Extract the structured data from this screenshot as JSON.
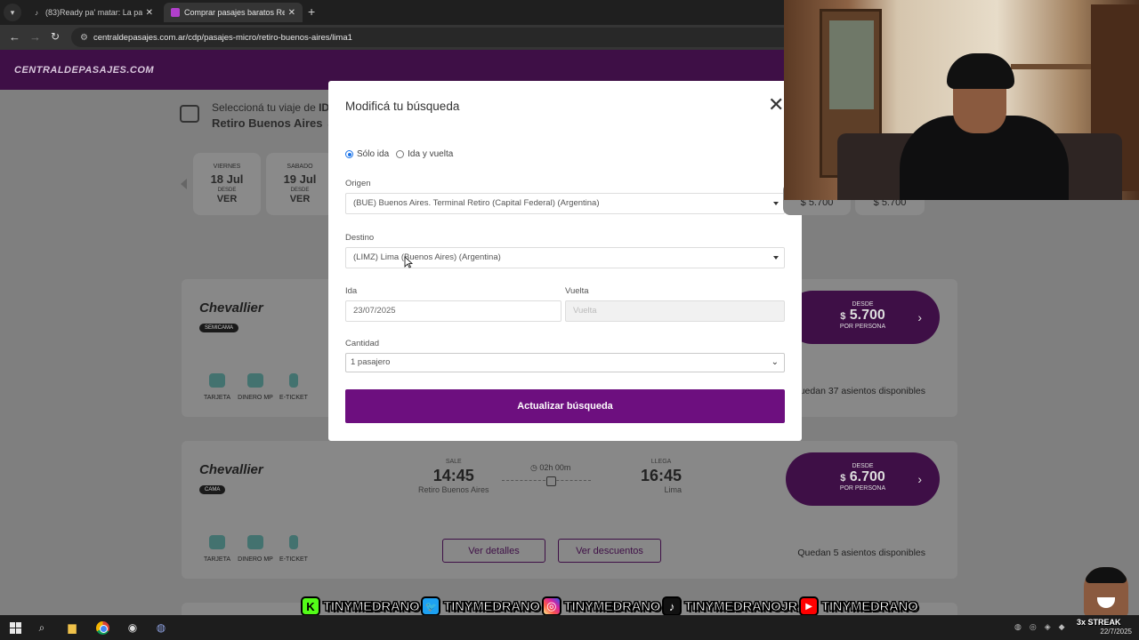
{
  "browser": {
    "tabs": [
      {
        "title": "(83)Ready pa' matar: La pasión d",
        "icon": "tiktok-icon"
      },
      {
        "title": "Comprar pasajes baratos Retiro",
        "icon": "site-icon",
        "active": true
      }
    ],
    "url": "centraldepasajes.com.ar/cdp/pasajes-micro/retiro-buenos-aires/lima1"
  },
  "site": {
    "logo": "CENTRALDEPASAJES.COM"
  },
  "trip": {
    "select_text": "Seleccioná tu viaje de",
    "select_strong": "IDA",
    "origin": "Retiro Buenos Aires",
    "arrow": "→"
  },
  "dates": [
    {
      "dow": "VIERNES",
      "date": "18 Jul",
      "desde": "DESDE",
      "ver": "VER"
    },
    {
      "dow": "SABADO",
      "date": "19 Jul",
      "desde": "DESDE",
      "ver": "VER"
    }
  ],
  "right_prices": [
    "$ 5.700",
    "$ 5.700"
  ],
  "results": [
    {
      "company": "Chevallier",
      "seat_type": "SEMICAMA",
      "price_desde": "DESDE",
      "price_currency": "$",
      "price": "5.700",
      "per_person": "POR PERSONA",
      "seats_text": "Quedan 37 asientos disponibles",
      "amenities": [
        "TARJETA",
        "DINERO MP",
        "E-TICKET"
      ]
    },
    {
      "company": "Chevallier",
      "seat_type": "CAMA",
      "sale_label": "SALE",
      "depart_time": "14:45",
      "depart_place": "Retiro Buenos Aires",
      "duration": "02h 00m",
      "arrive_label": "LLEGA",
      "arrive_time": "16:45",
      "arrive_place": "Lima",
      "details_button": "Ver detalles",
      "discounts_button": "Ver descuentos",
      "price_desde": "DESDE",
      "price_currency": "$",
      "price": "6.700",
      "per_person": "POR PERSONA",
      "seats_text": "Quedan 5 asientos disponibles",
      "amenities": [
        "TARJETA",
        "DINERO MP",
        "E-TICKET"
      ]
    }
  ],
  "modal": {
    "title": "Modificá tu búsqueda",
    "trip_type": {
      "one_way": "Sólo ida",
      "round_trip": "Ida y vuelta",
      "selected": "Sólo ida"
    },
    "origin_label": "Origen",
    "origin_value": "(BUE) Buenos Aires. Terminal Retiro (Capital Federal) (Argentina)",
    "destination_label": "Destino",
    "destination_value": "(LIMZ) Lima (Buenos Aires) (Argentina)",
    "ida_label": "Ida",
    "ida_value": "23/07/2025",
    "vuelta_label": "Vuelta",
    "vuelta_placeholder": "Vuelta",
    "cantidad_label": "Cantidad",
    "cantidad_value": "1 pasajero",
    "submit": "Actualizar búsqueda"
  },
  "social": [
    {
      "icon": "kick-icon",
      "name": "TINYMEDRANO",
      "color": "#53fc18",
      "glyph": "K"
    },
    {
      "icon": "twitter-icon",
      "name": "TINYMEDRANO",
      "color": "#1da1f2",
      "glyph": "🐦"
    },
    {
      "icon": "instagram-icon",
      "name": "TINYMEDRANO",
      "color": "#d6249f",
      "glyph": "◎"
    },
    {
      "icon": "tiktok-icon",
      "name": "TINYMEDRANOJR",
      "color": "#111111",
      "glyph": "♪"
    },
    {
      "icon": "youtube-icon",
      "name": "TINYMEDRANO",
      "color": "#ff0000",
      "glyph": "▶"
    }
  ],
  "streak": "3x STREAK",
  "taskbar": {
    "date": "22/7/2025"
  }
}
